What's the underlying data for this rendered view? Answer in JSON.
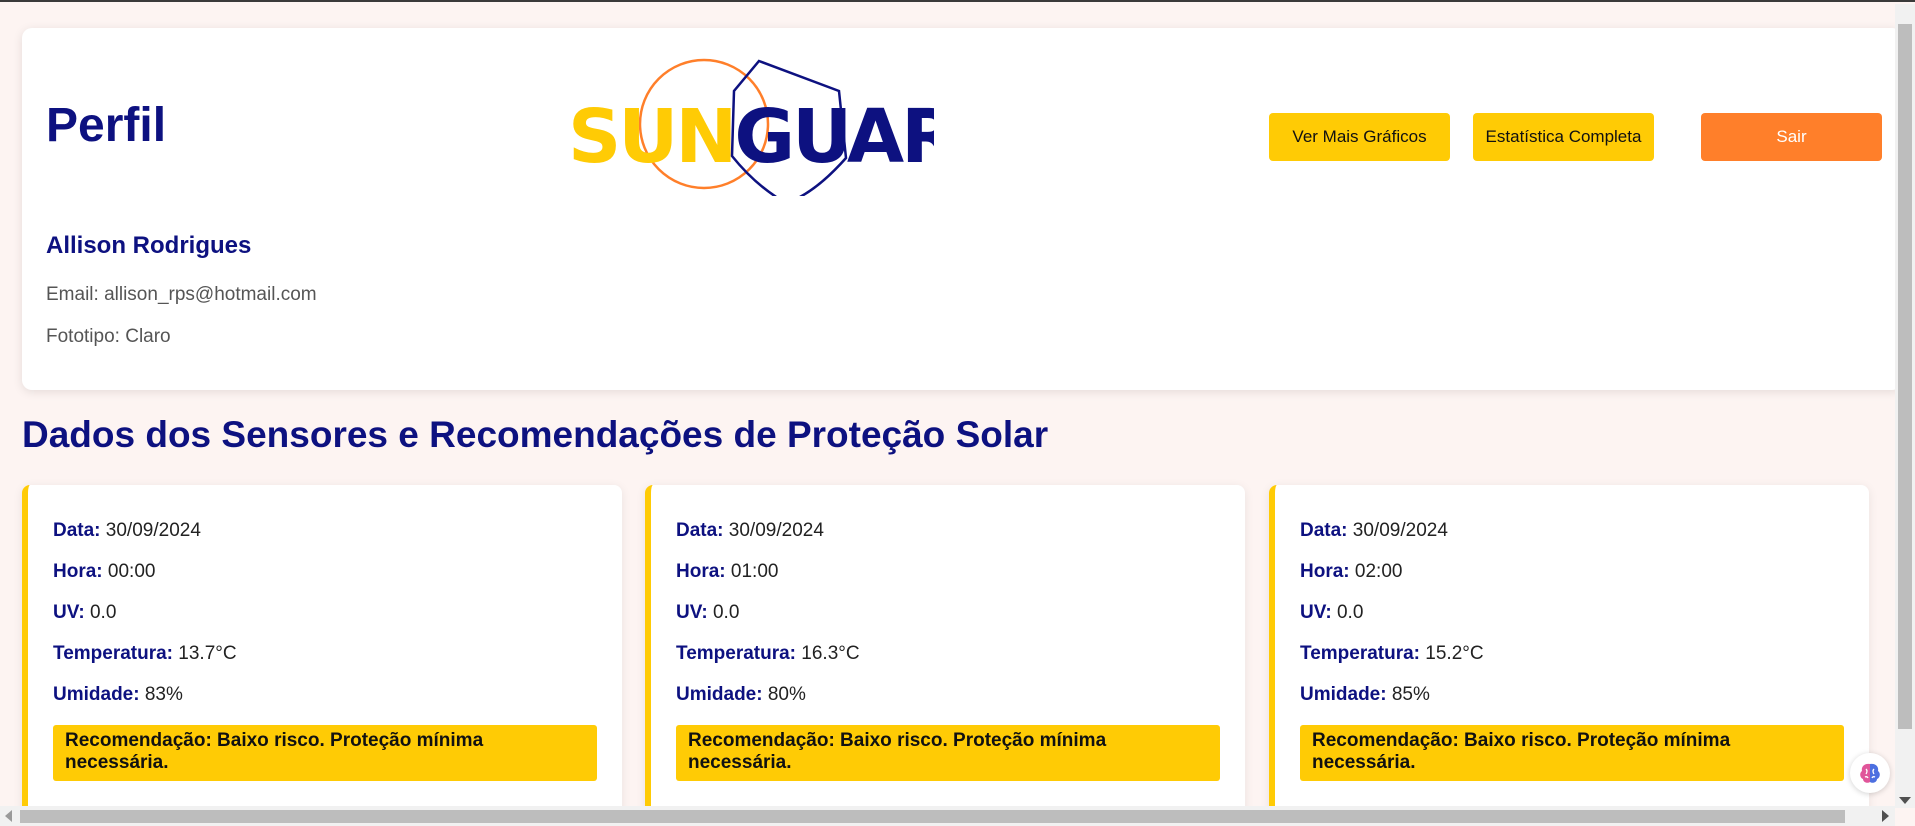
{
  "header": {
    "title": "Perfil",
    "logo": {
      "part1": "SUN",
      "part2": "GUARD"
    },
    "buttons": {
      "more_charts": "Ver Mais Gráficos",
      "full_stats": "Estatística Completa",
      "logout": "Sair"
    }
  },
  "profile": {
    "name": "Allison Rodrigues",
    "email_label": "Email:",
    "email": "allison_rps@hotmail.com",
    "phototype_label": "Fototipo:",
    "phototype": "Claro"
  },
  "section": {
    "title": "Dados dos Sensores e Recomendações de Proteção Solar"
  },
  "labels": {
    "date": "Data:",
    "hour": "Hora:",
    "uv": "UV:",
    "temperature": "Temperatura:",
    "humidity": "Umidade:"
  },
  "readings": [
    {
      "date": "30/09/2024",
      "hour": "00:00",
      "uv": "0.0",
      "temperature": "13.7°C",
      "humidity": "83%",
      "recommendation": "Recomendação: Baixo risco. Proteção mínima necessária."
    },
    {
      "date": "30/09/2024",
      "hour": "01:00",
      "uv": "0.0",
      "temperature": "16.3°C",
      "humidity": "80%",
      "recommendation": "Recomendação: Baixo risco. Proteção mínima necessária."
    },
    {
      "date": "30/09/2024",
      "hour": "02:00",
      "uv": "0.0",
      "temperature": "15.2°C",
      "humidity": "85%",
      "recommendation": "Recomendação: Baixo risco. Proteção mínima necessária."
    }
  ],
  "colors": {
    "primary_navy": "#0d1180",
    "accent_yellow": "#ffcb05",
    "accent_orange": "#ff7f2a",
    "background": "#fdf4f2"
  },
  "icons": {
    "ai_assistant": "brain-icon"
  }
}
